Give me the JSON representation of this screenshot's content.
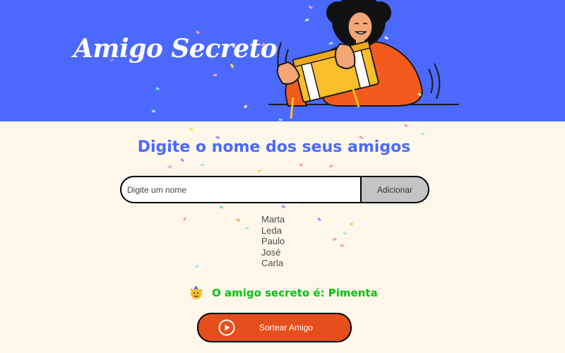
{
  "header": {
    "title": "Amigo Secreto",
    "illustration": "person-holding-gift-box"
  },
  "main": {
    "heading": "Digite o nome dos seus amigos",
    "input": {
      "placeholder": "Digite um nome",
      "value": ""
    },
    "add_button_label": "Adicionar",
    "friends": [
      "Marta",
      "Leda",
      "Paulo",
      "José",
      "Carla"
    ],
    "result_text": "O amigo secreto é: Pimenta",
    "result_icon": "party-face-icon",
    "draw_button_label": "Sortear Amigo",
    "draw_button_icon": "play-icon"
  },
  "colors": {
    "header_bg": "#4b69fd",
    "page_bg": "#fff8ea",
    "heading": "#4b69fd",
    "result": "#05c212",
    "draw_button": "#e64e1c",
    "add_button": "#c4c4c4"
  }
}
